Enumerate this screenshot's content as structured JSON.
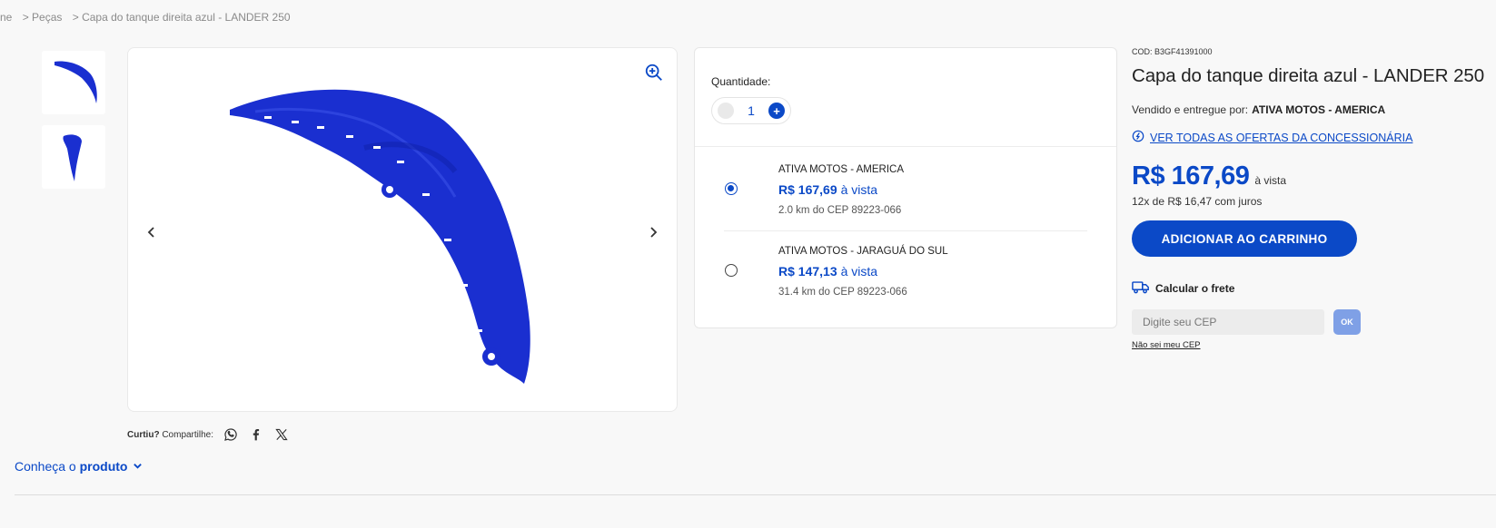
{
  "breadcrumb": {
    "items": [
      "ne",
      "> Peças",
      "> Capa do tanque direita azul - LANDER 250"
    ]
  },
  "gallery": {
    "thumbnails": [
      "thumbnail-1",
      "thumbnail-2"
    ],
    "icons": {
      "zoom": "zoom-in-icon",
      "prev": "chevron-left-icon",
      "next": "chevron-right-icon"
    }
  },
  "share": {
    "label_bold": "Curtiu?",
    "label": " Compartilhe:",
    "icons": [
      "whatsapp-icon",
      "facebook-icon",
      "x-icon"
    ]
  },
  "conheca": {
    "prefix": "Conheça o ",
    "bold": "produto"
  },
  "offers": {
    "quantity_label": "Quantidade:",
    "quantity_value": "1",
    "items": [
      {
        "seller": "ATIVA MOTOS - AMERICA",
        "price": "R$ 167,69",
        "vista": "à vista",
        "distance": "2.0 km do CEP 89223-066",
        "selected": true
      },
      {
        "seller": "ATIVA MOTOS - JARAGUÁ DO SUL",
        "price": "R$ 147,13",
        "vista": "à vista",
        "distance": "31.4 km do CEP 89223-066",
        "selected": false
      }
    ]
  },
  "product": {
    "cod": "COD: B3GF41391000",
    "title": "Capa do tanque direita azul - LANDER 250",
    "seller_label": "Vendido e entregue por:",
    "seller_name": "ATIVA MOTOS - AMERICA",
    "all_offers_link": "VER TODAS AS OFERTAS DA CONCESSIONÁRIA",
    "price": "R$ 167,69",
    "price_vista": "à vista",
    "installments": "12x de R$ 16,47 com juros",
    "add_to_cart": "ADICIONAR AO CARRINHO",
    "frete_label": "Calcular o frete",
    "cep_placeholder": "Digite seu CEP",
    "ok_label": "OK",
    "nao_sei": "Não sei meu CEP"
  },
  "colors": {
    "accent": "#0b49c7",
    "product_blue": "#1a2fd0",
    "ok_button": "#7fa0e6"
  }
}
